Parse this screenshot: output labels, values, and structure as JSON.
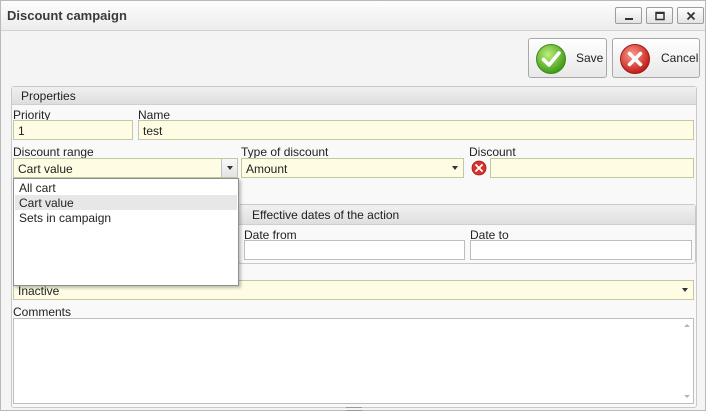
{
  "window": {
    "title": "Discount campaign"
  },
  "toolbar": {
    "save_label": "Save",
    "cancel_label": "Cancel"
  },
  "properties": {
    "header": "Properties",
    "priority_label": "Priority",
    "priority_value": "1",
    "name_label": "Name",
    "name_value": "test",
    "discount_range_label": "Discount range",
    "discount_range_value": "Cart value",
    "discount_range_options": [
      "All cart",
      "Cart value",
      "Sets in campaign"
    ],
    "type_label": "Type of discount",
    "type_value": "Amount",
    "discount_label": "Discount",
    "discount_value": "",
    "dates_header": "Effective dates of the action",
    "date_from_label": "Date from",
    "date_from_value": "",
    "date_to_label": "Date to",
    "date_to_value": "",
    "status_value": "Inactive",
    "comments_label": "Comments",
    "comments_value": ""
  },
  "colors": {
    "required_field_bg": "#fefde4",
    "save_icon": "#5bb52a",
    "cancel_icon": "#d8322c",
    "error_icon": "#d8322c"
  }
}
